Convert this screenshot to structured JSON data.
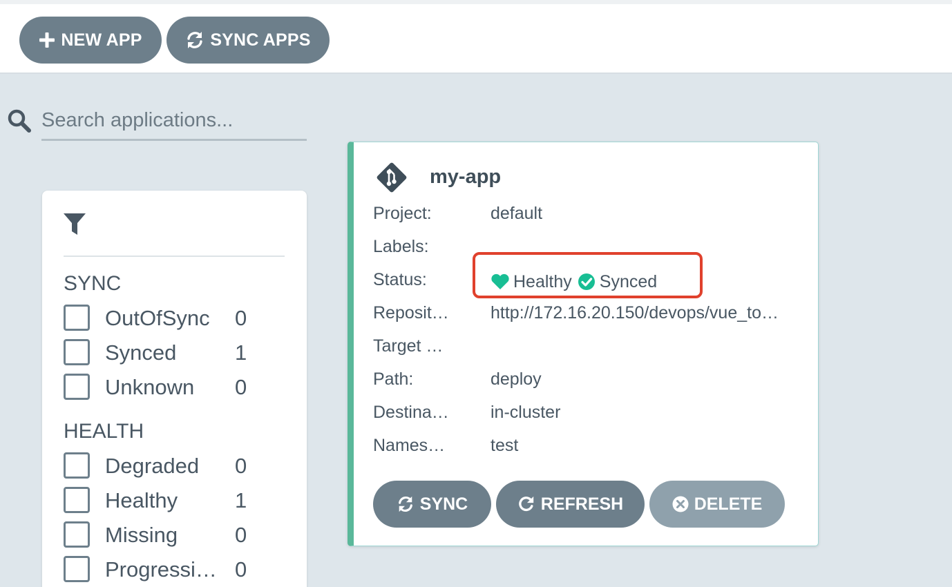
{
  "toolbar": {
    "new_app_label": "NEW APP",
    "sync_apps_label": "SYNC APPS"
  },
  "search": {
    "placeholder": "Search applications..."
  },
  "filters": {
    "sync_title": "SYNC",
    "sync_items": [
      {
        "label": "OutOfSync",
        "count": "0"
      },
      {
        "label": "Synced",
        "count": "1"
      },
      {
        "label": "Unknown",
        "count": "0"
      }
    ],
    "health_title": "HEALTH",
    "health_items": [
      {
        "label": "Degraded",
        "count": "0"
      },
      {
        "label": "Healthy",
        "count": "1"
      },
      {
        "label": "Missing",
        "count": "0"
      },
      {
        "label": "Progressi…",
        "count": "0"
      }
    ]
  },
  "app": {
    "name": "my-app",
    "rows": [
      {
        "label": "Project:",
        "value": "default"
      },
      {
        "label": "Labels:",
        "value": ""
      },
      {
        "label": "Status:",
        "value": ""
      },
      {
        "label": "Reposit…",
        "value": "http://172.16.20.150/devops/vue_to…"
      },
      {
        "label": "Target …",
        "value": ""
      },
      {
        "label": "Path:",
        "value": "deploy"
      },
      {
        "label": "Destina…",
        "value": "in-cluster"
      },
      {
        "label": "Names…",
        "value": "test"
      }
    ],
    "health_status": "Healthy",
    "sync_status": "Synced",
    "buttons": {
      "sync": "SYNC",
      "refresh": "REFRESH",
      "delete": "DELETE"
    }
  },
  "colors": {
    "accent_green": "#5ab89a",
    "button_gray": "#6d7f8b",
    "button_disabled": "#8fa1ac",
    "highlight_red": "#e0412d",
    "status_green": "#18be94"
  },
  "icons": [
    "plus-icon",
    "sync-icon",
    "search-icon",
    "filter-icon",
    "git-icon",
    "heart-icon",
    "check-circle-icon",
    "refresh-icon",
    "times-circle-icon"
  ]
}
